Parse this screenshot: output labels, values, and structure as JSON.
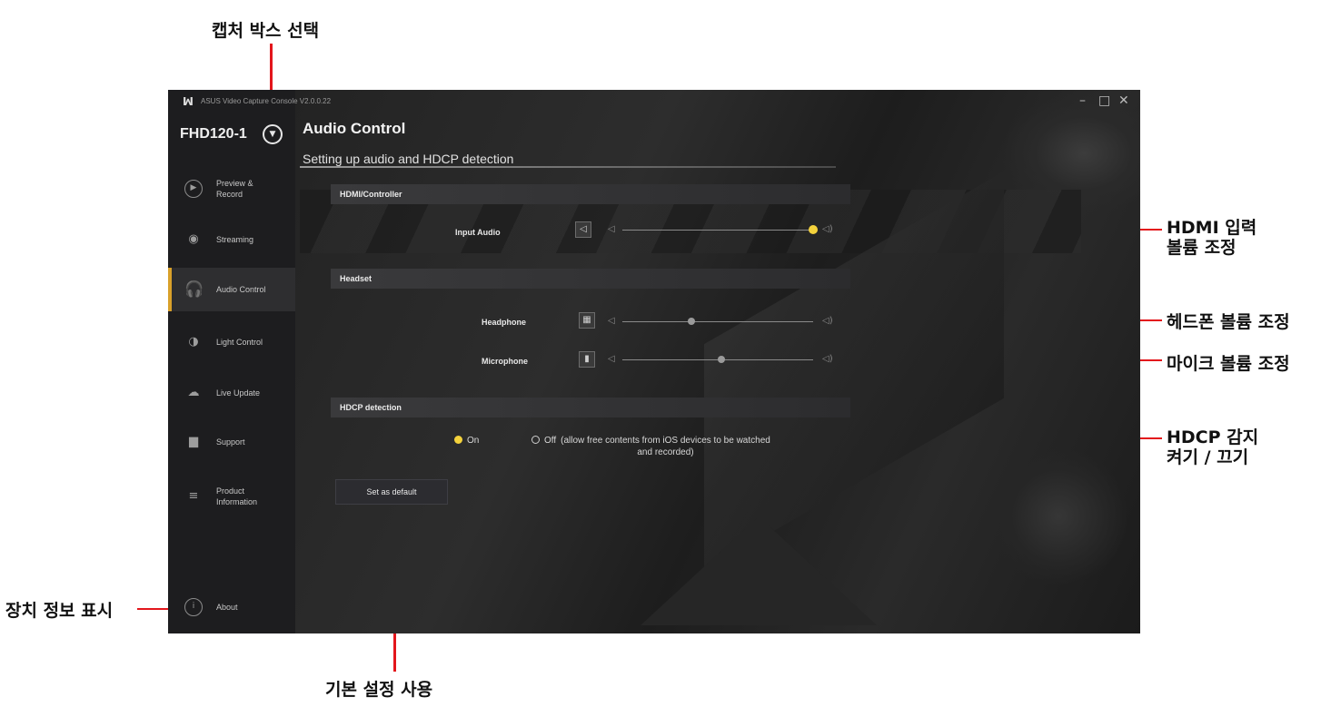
{
  "annotations": {
    "capture_box_select": "캡처 박스 선택",
    "hdmi_volume": [
      "HDMI 입력",
      "볼륨 조정"
    ],
    "headphone_volume": "헤드폰 볼륨 조정",
    "mic_volume": "마이크 볼륨 조정",
    "hdcp_toggle": [
      "HDCP 감지",
      "켜기 / 끄기"
    ],
    "device_info": "장치 정보 표시",
    "use_default": "기본 설정 사용",
    "line_color": "#e3161c"
  },
  "window": {
    "title": "ASUS Video Capture Console V2.0.0.22",
    "logo_icon": "tuf-logo-icon",
    "controls": [
      "–",
      "□",
      "✕"
    ]
  },
  "sidebar": {
    "device_name": "FHD120-1",
    "device_select_icon": "chevron-down-circle-icon",
    "items": [
      {
        "label": "Preview &\nRecord",
        "icon": "▶",
        "icon_name": "play-circle-icon"
      },
      {
        "label": "Streaming",
        "icon": "◉",
        "icon_name": "broadcast-icon"
      },
      {
        "label": "Audio Control",
        "icon": "🎧",
        "icon_name": "headset-icon",
        "active": true
      },
      {
        "label": "Light Control",
        "icon": "◑",
        "icon_name": "light-drop-icon"
      },
      {
        "label": "Live Update",
        "icon": "☁",
        "icon_name": "cloud-icon"
      },
      {
        "label": "Support",
        "icon": "▆",
        "icon_name": "support-icon"
      },
      {
        "label": "Product\nInformation",
        "icon": "≡",
        "icon_name": "list-icon"
      },
      {
        "label": "About",
        "icon": "i",
        "icon_name": "info-circle-icon"
      }
    ],
    "accent_color": "#d9a12a"
  },
  "main": {
    "title": "Audio Control",
    "subtitle": "Setting up audio and HDCP detection",
    "sections": {
      "hdmi": "HDMI/Controller",
      "headset": "Headset",
      "hdcp": "HDCP detection"
    },
    "input_audio": {
      "label": "Input Audio",
      "level": 1.0
    },
    "headphone": {
      "label": "Headphone",
      "level": 0.36
    },
    "microphone": {
      "label": "Microphone",
      "level": 0.52
    },
    "hdcp_options": {
      "on": "On",
      "off": "Off",
      "off_note": "(allow free contents from iOS devices to be watched\nand recorded)",
      "selected": "on"
    },
    "default_button": "Set as default",
    "slider_active_color": "#f4d23c"
  }
}
